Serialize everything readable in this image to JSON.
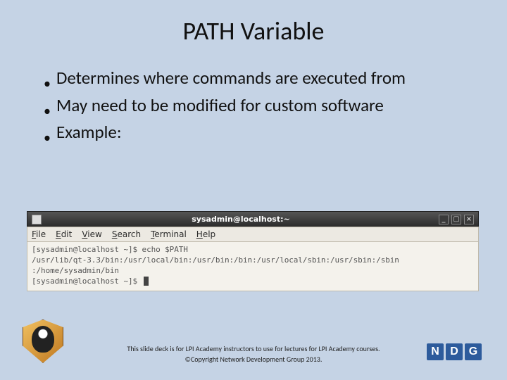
{
  "title": "PATH Variable",
  "bullets": [
    "Determines where commands are executed from",
    "May need to be modified for custom software",
    "Example:"
  ],
  "terminal": {
    "window_title": "sysadmin@localhost:~",
    "menu": {
      "file": "File",
      "edit": "Edit",
      "view": "View",
      "search": "Search",
      "terminal": "Terminal",
      "help": "Help"
    },
    "lines": {
      "l1": "[sysadmin@localhost ~]$ echo $PATH",
      "l2": "/usr/lib/qt-3.3/bin:/usr/local/bin:/usr/bin:/bin:/usr/local/sbin:/usr/sbin:/sbin",
      "l3": ":/home/sysadmin/bin",
      "l4": "[sysadmin@localhost ~]$ "
    }
  },
  "footer": {
    "line1": "This slide deck is for LPI Academy instructors to use for lectures for LPI Academy courses.",
    "line2": "©Copyright Network Development Group 2013."
  },
  "ndg": {
    "n": "N",
    "d": "D",
    "g": "G"
  }
}
